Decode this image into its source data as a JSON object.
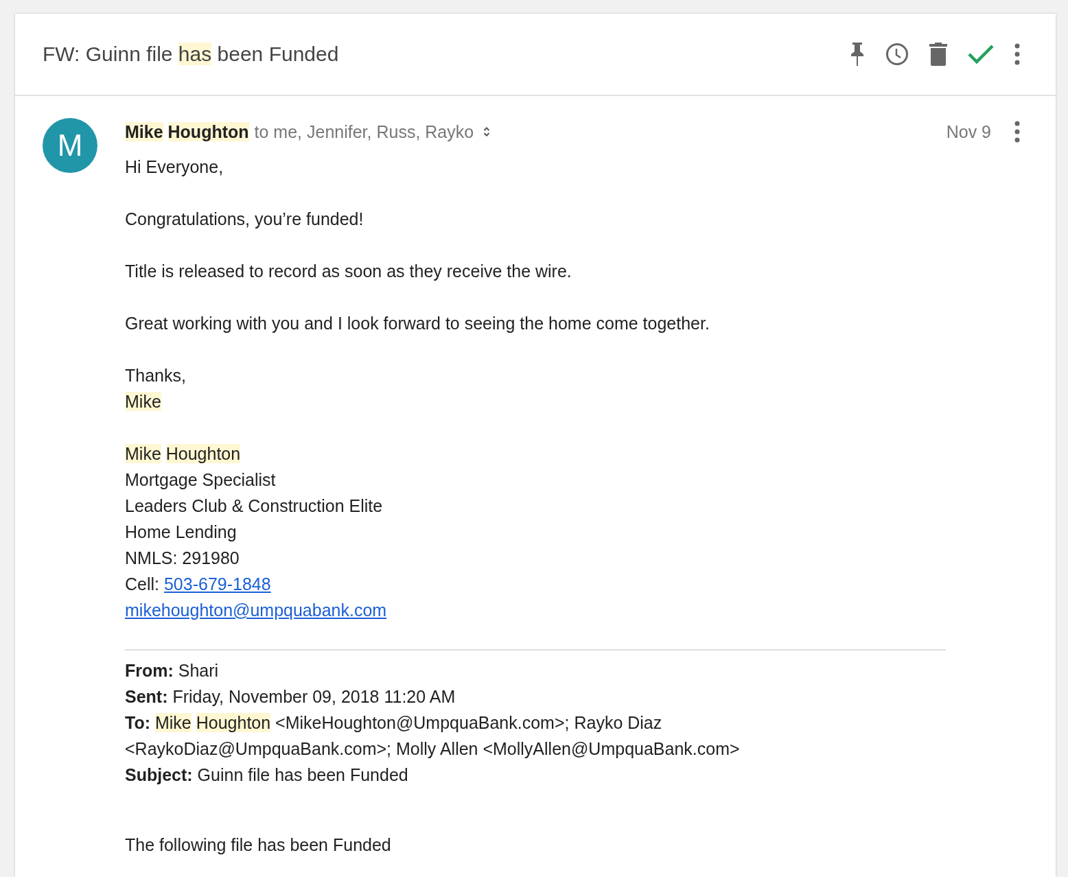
{
  "subject": [
    {
      "text": "FW: Guinn file ",
      "kind": "plain"
    },
    {
      "text": "has",
      "kind": "highlight"
    },
    {
      "text": " been Funded",
      "kind": "plain"
    }
  ],
  "message": {
    "avatar_letter": "M",
    "sender": [
      {
        "text": "Mike",
        "kind": "highlight",
        "space_after": true
      },
      {
        "text": "Houghton",
        "kind": "highlight"
      }
    ],
    "recipients": "to me, Jennifer, Russ, Rayko",
    "date": "Nov 9",
    "body": [
      {
        "lines": [
          [
            {
              "text": "Hi Everyone,",
              "kind": "plain"
            }
          ]
        ]
      },
      {
        "lines": [
          [
            {
              "text": "Congratulations, you’re funded!",
              "kind": "plain"
            }
          ]
        ]
      },
      {
        "lines": [
          [
            {
              "text": "Title is released to record as soon as they receive the wire.",
              "kind": "plain"
            }
          ]
        ]
      },
      {
        "lines": [
          [
            {
              "text": "Great working with you and I look forward to seeing the home come together.",
              "kind": "plain"
            }
          ]
        ]
      },
      {
        "lines": [
          [
            {
              "text": "Thanks,",
              "kind": "plain"
            }
          ],
          [
            {
              "text": "Mike",
              "kind": "highlight"
            }
          ]
        ]
      },
      {
        "lines": [
          [
            {
              "text": "Mike",
              "kind": "highlight",
              "space_after": true
            },
            {
              "text": "Houghton",
              "kind": "highlight"
            }
          ],
          [
            {
              "text": "Mortgage Specialist",
              "kind": "plain"
            }
          ],
          [
            {
              "text": "Leaders Club & Construction Elite",
              "kind": "plain"
            }
          ],
          [
            {
              "text": "Home Lending",
              "kind": "plain"
            }
          ],
          [
            {
              "text": "NMLS: 291980",
              "kind": "plain"
            }
          ],
          [
            {
              "text": "Cell: ",
              "kind": "plain"
            },
            {
              "text": "503-679-1848",
              "kind": "link"
            }
          ],
          [
            {
              "text": "mikehoughton@umpquabank.com",
              "kind": "link"
            }
          ]
        ]
      }
    ],
    "forwarded": {
      "lines": [
        [
          {
            "text": "From:",
            "kind": "bold"
          },
          {
            "text": " Shari",
            "kind": "plain"
          }
        ],
        [
          {
            "text": "Sent:",
            "kind": "bold"
          },
          {
            "text": " Friday, November 09, 2018 11:20 AM",
            "kind": "plain"
          }
        ],
        [
          {
            "text": "To:",
            "kind": "bold",
            "space_after": true
          },
          {
            "text": "Mike",
            "kind": "highlight",
            "space_after": true
          },
          {
            "text": "Houghton",
            "kind": "highlight"
          },
          {
            "text": " <MikeHoughton@UmpquaBank.com>; Rayko Diaz <RaykoDiaz@UmpquaBank.com>; Molly Allen <MollyAllen@UmpquaBank.com>",
            "kind": "plain"
          }
        ],
        [
          {
            "text": "Subject:",
            "kind": "bold"
          },
          {
            "text": " Guinn file has been Funded",
            "kind": "plain"
          }
        ]
      ],
      "closing": "The following file has been Funded"
    }
  }
}
